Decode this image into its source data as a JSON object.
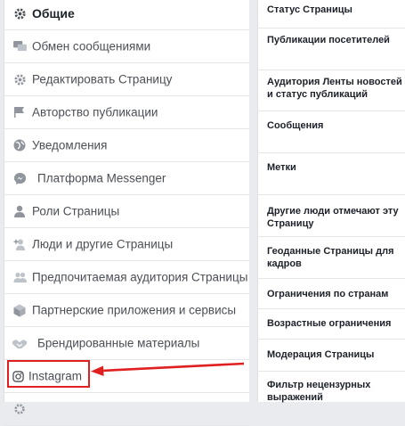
{
  "sidebar": {
    "items": [
      {
        "label": "Общие",
        "icon": "gear-icon"
      },
      {
        "label": "Обмен сообщениями",
        "icon": "chat-icon"
      },
      {
        "label": "Редактировать Страницу",
        "icon": "gear-icon"
      },
      {
        "label": "Авторство публикации",
        "icon": "flag-icon"
      },
      {
        "label": "Уведомления",
        "icon": "globe-icon"
      },
      {
        "label": "Платформа Messenger",
        "icon": "messenger-icon"
      },
      {
        "label": "Роли Страницы",
        "icon": "person-icon"
      },
      {
        "label": "Люди и другие Страницы",
        "icon": "add-person-icon"
      },
      {
        "label": "Предпочитаемая аудитория Страницы",
        "icon": "people-icon"
      },
      {
        "label": "Партнерские приложения и сервисы",
        "icon": "cube-icon"
      },
      {
        "label": "Брендированные материалы",
        "icon": "handshake-icon"
      },
      {
        "label": "Instagram",
        "icon": "instagram-icon"
      }
    ]
  },
  "settings": {
    "rows": [
      "Статус Страницы",
      "Публикации посетителей",
      "Аудитория Ленты новостей и статус публикаций",
      "Сообщения",
      "Метки",
      "Другие люди отмечают эту Страницу",
      "Геоданные Страницы для кадров",
      "Ограничения по странам",
      "Возрастные ограничения",
      "Модерация Страницы",
      "Фильтр нецензурных выражений"
    ]
  },
  "colors": {
    "highlight": "#e02020",
    "icon": "#90949c",
    "text": "#4b4f56"
  }
}
